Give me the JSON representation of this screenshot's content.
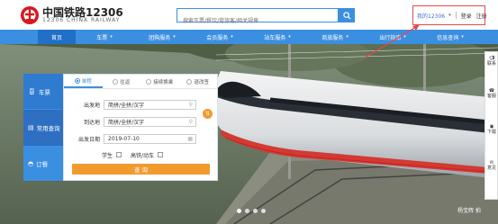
{
  "header": {
    "logo_title": "中国铁路12306",
    "logo_sub": "12306 CHINA RAILWAY",
    "search_placeholder": "搜索车票/餐饮/常旅客/相关规章",
    "my12306": "我的12306",
    "login": "登录",
    "register": "注册"
  },
  "nav": {
    "items": [
      {
        "label": "首页",
        "dropdown": false
      },
      {
        "label": "车票",
        "dropdown": true
      },
      {
        "label": "团购服务",
        "dropdown": true
      },
      {
        "label": "会员服务",
        "dropdown": true
      },
      {
        "label": "站车服务",
        "dropdown": true
      },
      {
        "label": "商旅服务",
        "dropdown": true
      },
      {
        "label": "出行指南",
        "dropdown": true
      },
      {
        "label": "信息查询",
        "dropdown": true
      }
    ],
    "active_index": 0
  },
  "side_tabs": [
    {
      "label": "车票",
      "icon": "train-icon"
    },
    {
      "label": "常用查询",
      "icon": "list-icon"
    },
    {
      "label": "订餐",
      "icon": "meal-icon"
    }
  ],
  "form": {
    "tabs": [
      "单程",
      "往返",
      "接续换乘",
      "退改签"
    ],
    "from_label": "出发地",
    "from_placeholder": "简拼/全拼/汉字",
    "to_label": "到达地",
    "to_placeholder": "简拼/全拼/汉字",
    "date_label": "出发日期",
    "date_value": "2019-07-10",
    "student_label": "学生",
    "highspeed_label": "高铁/动车",
    "swap_label": "⇅",
    "query_button": "查 询"
  },
  "float_panel": {
    "items": [
      "联系",
      "客服",
      "下载",
      "意见"
    ]
  },
  "watermark": "杨宝辉 拍",
  "colors": {
    "brand_blue": "#3b8fe0",
    "orange": "#f29a2d",
    "highlight_red": "#e34a4a"
  }
}
